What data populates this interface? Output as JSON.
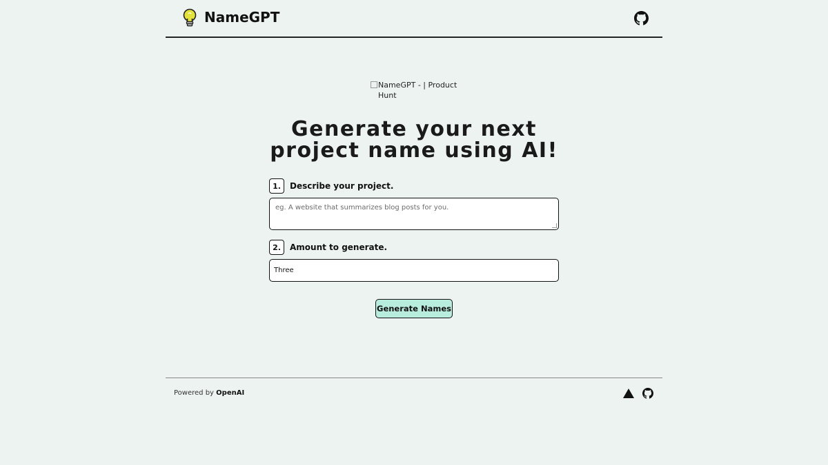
{
  "header": {
    "logo_icon": "lightbulb-icon",
    "title": "NameGPT",
    "github_icon": "github-icon"
  },
  "product_hunt": {
    "alt_text": "NameGPT - | Product Hunt"
  },
  "hero": {
    "title": "Generate your next project name using AI!"
  },
  "form": {
    "step1": {
      "number": "1.",
      "label": "Describe your project.",
      "placeholder": "eg. A website that summarizes blog posts for you."
    },
    "step2": {
      "number": "2.",
      "label": "Amount to generate.",
      "selected": "Three"
    },
    "button_label": "Generate Names"
  },
  "footer": {
    "powered_prefix": "Powered by",
    "powered_brand": "OpenAI",
    "vercel_icon": "vercel-icon",
    "github_icon": "github-icon"
  },
  "colors": {
    "background": "#ecf3f0",
    "button_bg": "#b8ecdc",
    "bulb_yellow": "#e3e23c"
  }
}
